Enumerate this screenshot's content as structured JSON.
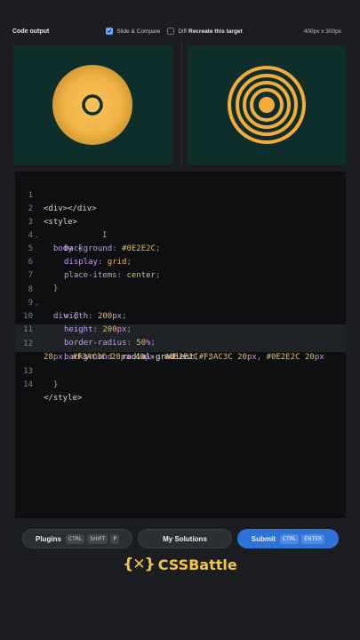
{
  "topbar": {
    "code_output": "Code output",
    "slide_compare": "Slide & Compare",
    "diff": "Diff",
    "recreate": "Recreate this target",
    "size": "400px x 300px"
  },
  "colors": {
    "panel_bg": "#0E2E2C",
    "accent": "#F3AC3C"
  },
  "code": {
    "lines": [
      {
        "n": "1"
      },
      {
        "n": "2"
      },
      {
        "n": "3"
      },
      {
        "n": "4"
      },
      {
        "n": "5"
      },
      {
        "n": "6"
      },
      {
        "n": "7"
      },
      {
        "n": "8"
      },
      {
        "n": "9"
      },
      {
        "n": "10"
      },
      {
        "n": "11"
      },
      {
        "n": "12"
      },
      {
        "n": "13"
      },
      {
        "n": "14"
      }
    ],
    "l1": "<div></div>",
    "l2": "<style>",
    "l3_sel": "body",
    "l3_brace": "{",
    "l4_prop": "background",
    "l4_val": "#0E2E2C",
    "l5_prop": "display",
    "l5_val": "grid",
    "l6_prop": "place-items",
    "l6_val": "center",
    "l7": "}",
    "l8_sel": "div",
    "l8_brace": "{",
    "l9_prop": "width",
    "l9_num": "200",
    "l9_unit": "px",
    "l10_prop": "height",
    "l10_num": "200",
    "l10_unit": "px",
    "l11_prop": "border-radius",
    "l11_num": "50",
    "l11_unit": "%",
    "l12_prop": "background",
    "l12_fn": "radial-gradient",
    "l12_a": "#F3AC3C",
    "l12_b": "20",
    "l12_c": "#0E2E2C",
    "l12_d": "20",
    "l12_e": "28",
    "l12_f": "#F3AC3C",
    "l12_g": "28",
    "l12_h": "40",
    "l12_i": "#0E2E2C",
    "l13": "}",
    "l14": "</style>"
  },
  "buttons": {
    "plugins": "Plugins",
    "plugins_keys": [
      "CTRL",
      "SHIFT",
      "P"
    ],
    "my_solutions": "My Solutions",
    "submit": "Submit",
    "submit_keys": [
      "CTRL",
      "ENTER"
    ]
  },
  "brand": {
    "logo": "{✕}",
    "name": "CSSBattle"
  }
}
